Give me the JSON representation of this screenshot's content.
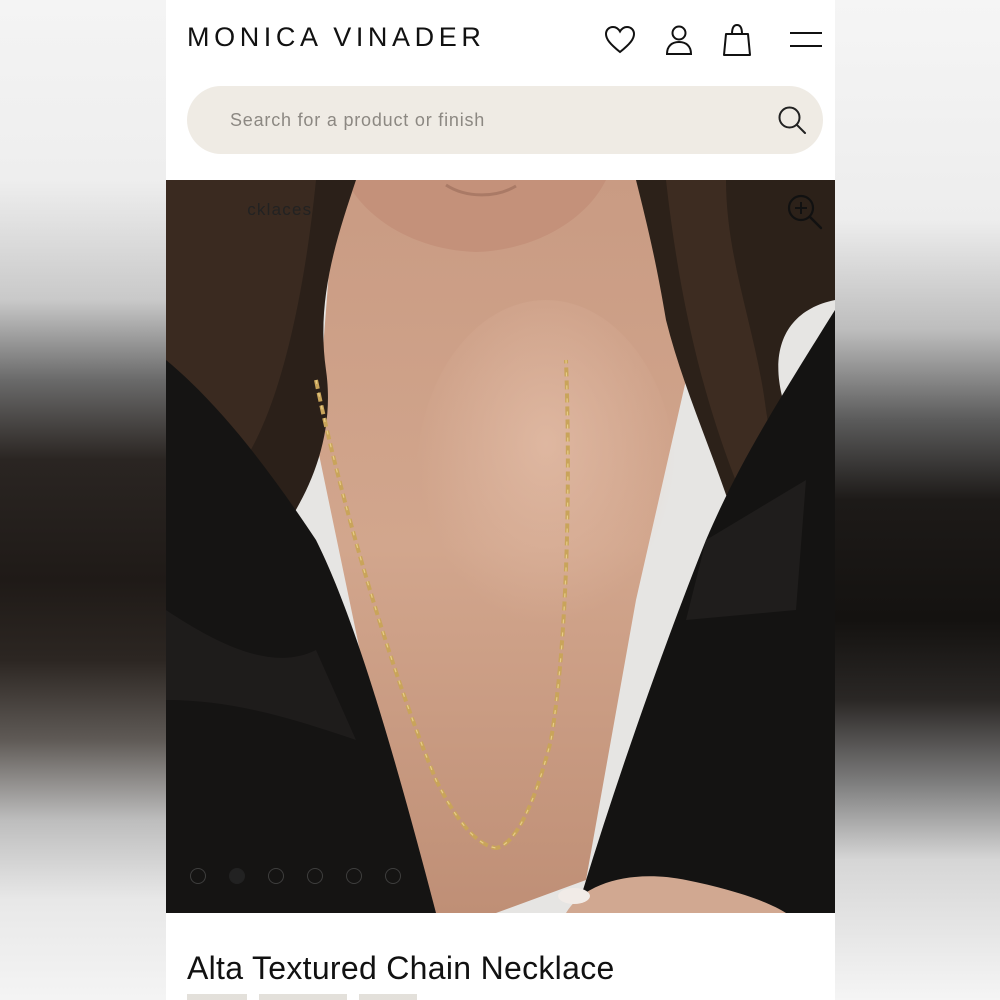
{
  "header": {
    "brand": "MONICA VINADER",
    "icons": [
      "heart-icon",
      "user-icon",
      "bag-icon",
      "menu-icon"
    ]
  },
  "search": {
    "placeholder": "Search for a product or finish",
    "value": ""
  },
  "hero": {
    "breadcrumb_visible": "cklaces",
    "carousel": {
      "total": 6,
      "active_index": 1
    }
  },
  "product": {
    "title": "Alta Textured Chain Necklace"
  },
  "colors": {
    "search_bg": "#efebe4",
    "text": "#111111",
    "jacket": "#161514",
    "gold": "#c9a45a"
  }
}
